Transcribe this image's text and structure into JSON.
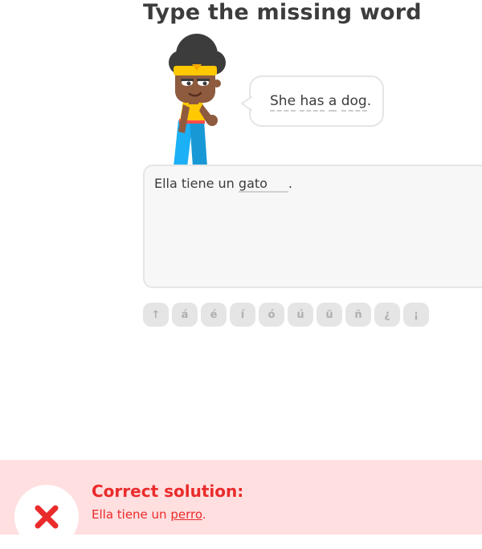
{
  "exercise": {
    "title": "Type the missing word"
  },
  "prompt": {
    "word1": "She",
    "word2": "has",
    "word3": "a",
    "word4": "dog",
    "punct": "."
  },
  "answer": {
    "before": "Ella tiene un",
    "typed": "gato",
    "after": "."
  },
  "keyboard": {
    "keys": [
      "↑",
      "á",
      "é",
      "í",
      "ó",
      "ú",
      "ü",
      "ñ",
      "¿",
      "¡"
    ]
  },
  "feedback": {
    "title": "Correct solution:",
    "solution_before": "Ella tiene un",
    "solution_word": "perro",
    "solution_after": "."
  },
  "colors": {
    "error": "#ea2b2b",
    "feedback_bg": "#ffdfe0"
  }
}
